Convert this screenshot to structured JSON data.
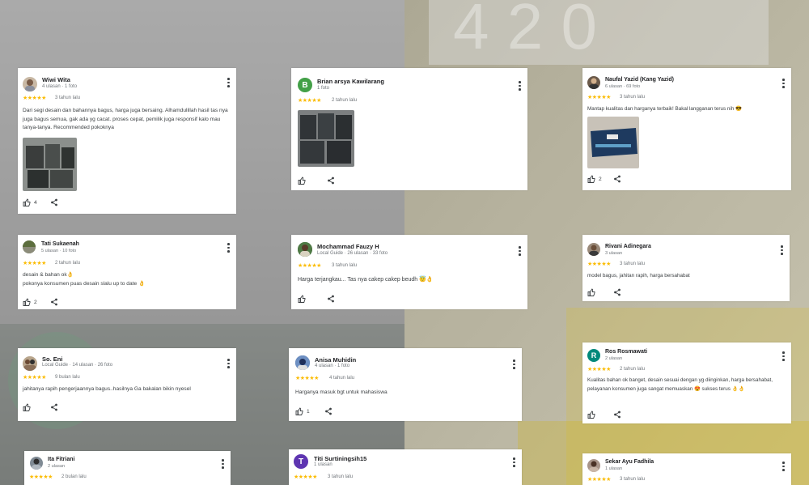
{
  "reviews": [
    {
      "name": "Wiwi Wita",
      "meta": "4 ulasan · 1 foto",
      "when": "3 tahun lalu",
      "text": "Dari segi desain dan bahannya bagus, harga juga bersaing. Alhamdulillah hasil tas nya juga bagus semua, gak ada yg cacat. proses cepat, pemilik juga responsif kalo mau tanya-tanya. Recommended pokoknya",
      "likes": "4"
    },
    {
      "name": "Brian arsya Kawilarang",
      "initial": "B",
      "meta": "1 foto",
      "when": "2 tahun lalu",
      "text": "",
      "likes": ""
    },
    {
      "name": "Naufal Yazid (Kang Yazid)",
      "meta": "6 ulasan · 69 foto",
      "when": "3 tahun lalu",
      "text": "Mantap kualitas dan harganya terbaik! Bakal langganan terus nih 😎",
      "likes": "2"
    },
    {
      "name": "Tati Sukaenah",
      "meta": "5 ulasan · 10 foto",
      "when": "2 tahun lalu",
      "text": "desain & bahan ok👌\npokonya konsumen puas desain slalu up to date 👌",
      "likes": "2"
    },
    {
      "name": "Mochammad Fauzy H",
      "meta": "Local Guide · 26 ulasan · 33 foto",
      "when": "3 tahun lalu",
      "text": "Harga terjangkau... Tas nya cakep cakep beudh 😇👌",
      "likes": ""
    },
    {
      "name": "Rivani Adinegara",
      "meta": "3 ulasan",
      "when": "3 tahun lalu",
      "text": "model bagus, jahitan rapih, harga bersahabat",
      "likes": ""
    },
    {
      "name": "So. Eni",
      "meta": "Local Guide · 14 ulasan · 26 foto",
      "when": "9 bulan lalu",
      "text": "jahitanya rapih pengerjaannya bagus..hasilnya Ga bakalan bikin nyesel",
      "likes": ""
    },
    {
      "name": "Anisa Muhidin",
      "meta": "4 ulasan · 1 foto",
      "when": "4 tahun lalu",
      "text": "Harganya masuk bgt untuk mahasiswa",
      "likes": "1"
    },
    {
      "name": "Ros Rosmawati",
      "initial": "R",
      "meta": "2 ulasan",
      "when": "2 tahun lalu",
      "text": "Kualitas bahan ok banget, desain sesuai dengan yg diinginkan, harga bersahabat, pelayanan konsumen juga sangat memuaskan 😍 sukses terus 👌👌",
      "likes": ""
    },
    {
      "name": "Ita Fitriani",
      "meta": "2 ulasan",
      "when": "2 bulan lalu",
      "text": "",
      "likes": ""
    },
    {
      "name": "Titi Surtiningsih15",
      "initial": "T",
      "meta": "1 ulasan",
      "when": "3 tahun lalu",
      "text": "",
      "likes": ""
    },
    {
      "name": "Sekar Ayu Fadhila",
      "meta": "1 ulasan",
      "when": "3 tahun lalu",
      "text": "",
      "likes": ""
    }
  ],
  "stars": "★★★★★",
  "colors": {
    "star": "#fbbc04",
    "avatar_b": "#43a047",
    "avatar_r": "#00897b",
    "avatar_t": "#5e35b1"
  }
}
